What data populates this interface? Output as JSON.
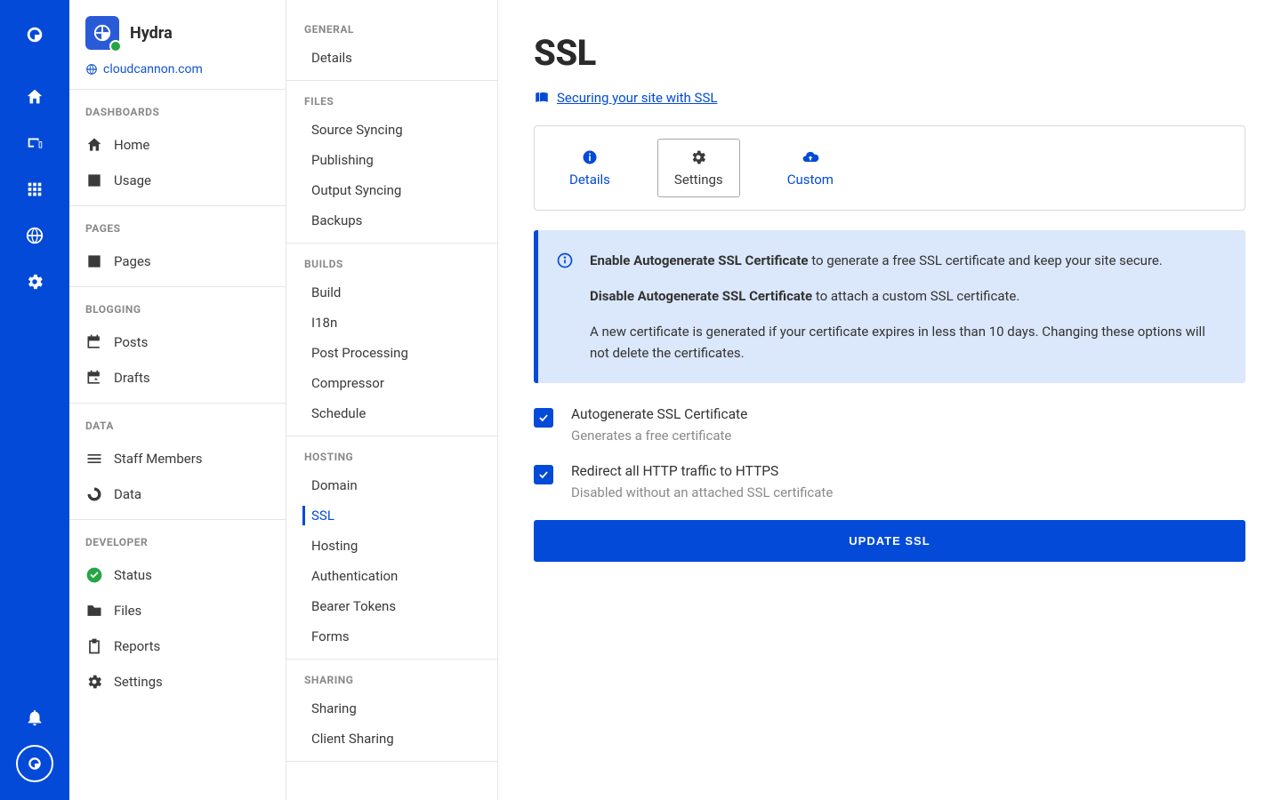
{
  "site": {
    "name": "Hydra",
    "domain": "cloudcannon.com"
  },
  "sidebar": {
    "sections": [
      {
        "heading": "DASHBOARDS",
        "items": [
          {
            "label": "Home",
            "icon": "home"
          },
          {
            "label": "Usage",
            "icon": "bar-chart"
          }
        ]
      },
      {
        "heading": "PAGES",
        "items": [
          {
            "label": "Pages",
            "icon": "page"
          }
        ]
      },
      {
        "heading": "BLOGGING",
        "items": [
          {
            "label": "Posts",
            "icon": "calendar"
          },
          {
            "label": "Drafts",
            "icon": "calendar-edit"
          }
        ]
      },
      {
        "heading": "DATA",
        "items": [
          {
            "label": "Staff Members",
            "icon": "list"
          },
          {
            "label": "Data",
            "icon": "donut"
          }
        ]
      },
      {
        "heading": "DEVELOPER",
        "items": [
          {
            "label": "Status",
            "icon": "check-circle",
            "class": "status"
          },
          {
            "label": "Files",
            "icon": "folder"
          },
          {
            "label": "Reports",
            "icon": "clipboard"
          },
          {
            "label": "Settings",
            "icon": "gear"
          }
        ]
      }
    ]
  },
  "settings": {
    "sections": [
      {
        "heading": "GENERAL",
        "items": [
          "Details"
        ]
      },
      {
        "heading": "FILES",
        "items": [
          "Source Syncing",
          "Publishing",
          "Output Syncing",
          "Backups"
        ]
      },
      {
        "heading": "BUILDS",
        "items": [
          "Build",
          "I18n",
          "Post Processing",
          "Compressor",
          "Schedule"
        ]
      },
      {
        "heading": "HOSTING",
        "items": [
          "Domain",
          "SSL",
          "Hosting",
          "Authentication",
          "Bearer Tokens",
          "Forms"
        ],
        "active": "SSL"
      },
      {
        "heading": "SHARING",
        "items": [
          "Sharing",
          "Client Sharing"
        ]
      }
    ]
  },
  "page": {
    "title": "SSL",
    "doc_link": "Securing your site with SSL",
    "tabs": [
      {
        "label": "Details",
        "icon": "info"
      },
      {
        "label": "Settings",
        "icon": "gear",
        "active": true
      },
      {
        "label": "Custom",
        "icon": "cloud-up"
      }
    ],
    "banner": {
      "enable_strong": "Enable Autogenerate SSL Certificate",
      "enable_rest": " to generate a free SSL certificate and keep your site secure.",
      "disable_strong": "Disable Autogenerate SSL Certificate",
      "disable_rest": " to attach a custom SSL certificate.",
      "note": "A new certificate is generated if your certificate expires in less than 10 days. Changing these options will not delete the certificates."
    },
    "checks": [
      {
        "label": "Autogenerate SSL Certificate",
        "help": "Generates a free certificate",
        "checked": true
      },
      {
        "label": "Redirect all HTTP traffic to HTTPS",
        "help": "Disabled without an attached SSL certificate",
        "checked": true
      }
    ],
    "button": "UPDATE SSL"
  }
}
